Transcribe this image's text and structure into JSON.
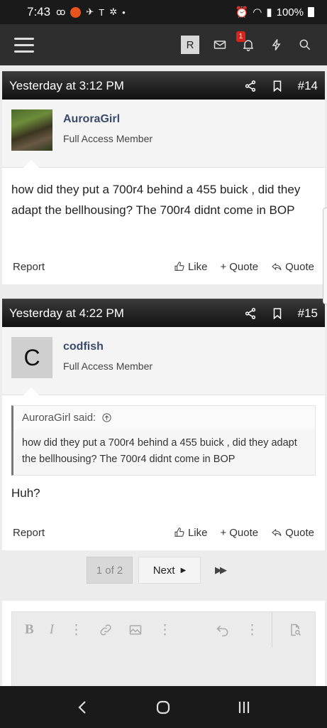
{
  "status_bar": {
    "time": "7:43",
    "battery": "100%"
  },
  "nav": {
    "avatar_letter": "R",
    "alerts_badge": "1"
  },
  "posts": [
    {
      "timestamp": "Yesterday at 3:12 PM",
      "number": "#14",
      "username": "AuroraGirl",
      "user_title": "Full Access Member",
      "body": "how did they put a 700r4 behind a 455 buick , did they adapt the bellhousing? The 700r4 didnt come in BOP",
      "actions": {
        "report": "Report",
        "like": "Like",
        "quote_plus": "Quote",
        "quote_reply": "Quote"
      }
    },
    {
      "timestamp": "Yesterday at 4:22 PM",
      "number": "#15",
      "avatar_letter": "C",
      "username": "codfish",
      "user_title": "Full Access Member",
      "quote": {
        "author_said": "AuroraGirl said:",
        "text": "how did they put a 700r4 behind a 455 buick , did they adapt the bellhousing? The 700r4 didnt come in BOP"
      },
      "body": "Huh?",
      "actions": {
        "report": "Report",
        "like": "Like",
        "quote_plus": "Quote",
        "quote_reply": "Quote"
      }
    }
  ],
  "pagination": {
    "current": "1 of 2",
    "next": "Next"
  },
  "editor": {
    "toolbar": [
      "bold-icon",
      "italic-icon",
      "more-icon",
      "link-icon",
      "image-icon",
      "more-icon",
      "undo-icon",
      "more-icon",
      "preview-icon"
    ]
  }
}
